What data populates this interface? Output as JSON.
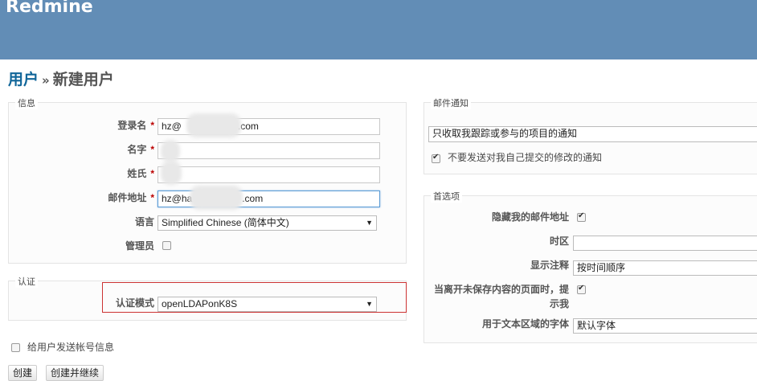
{
  "app": {
    "brand": "Redmine"
  },
  "breadcrumb": {
    "parent": "用户",
    "separator": "»",
    "current": "新建用户"
  },
  "info": {
    "legend": "信息",
    "login": {
      "label": "登录名",
      "value_prefix": "hz@",
      "value_suffix": ".com"
    },
    "firstname": {
      "label": "名字",
      "value": ""
    },
    "lastname": {
      "label": "姓氏",
      "value": ""
    },
    "email": {
      "label": "邮件地址",
      "value_prefix": "hz@ha",
      "value_suffix": ".com"
    },
    "required_mark": "*",
    "language": {
      "label": "语言",
      "selected": "Simplified Chinese (简体中文)"
    },
    "admin": {
      "label": "管理员",
      "checked": false
    }
  },
  "auth": {
    "legend": "认证",
    "mode_label": "认证模式",
    "mode_selected": "openLDAPonK8S"
  },
  "send_info": {
    "label": "给用户发送帐号信息",
    "checked": false
  },
  "mail": {
    "legend": "邮件通知",
    "selected": "只收取我跟踪或参与的项目的通知",
    "no_self_notified": {
      "label": "不要发送对我自己提交的修改的通知",
      "checked": true
    }
  },
  "prefs": {
    "legend": "首选项",
    "hide_mail": {
      "label": "隐藏我的邮件地址",
      "checked": true
    },
    "timezone": {
      "label": "时区",
      "value": ""
    },
    "comments_order": {
      "label": "显示注释",
      "selected": "按时间顺序"
    },
    "warn_leaving_line1": "当离开未保存内容的页面时，提",
    "warn_leaving_line2": "示我",
    "warn_leaving_checked": true,
    "textarea_font": {
      "label": "用于文本区域的字体",
      "selected": "默认字体"
    }
  },
  "buttons": {
    "create": "创建",
    "create_continue": "创建并继续"
  },
  "colors": {
    "header": "#628db6",
    "link": "#116699",
    "required": "#bb0000",
    "highlight_border": "#cc3333"
  }
}
